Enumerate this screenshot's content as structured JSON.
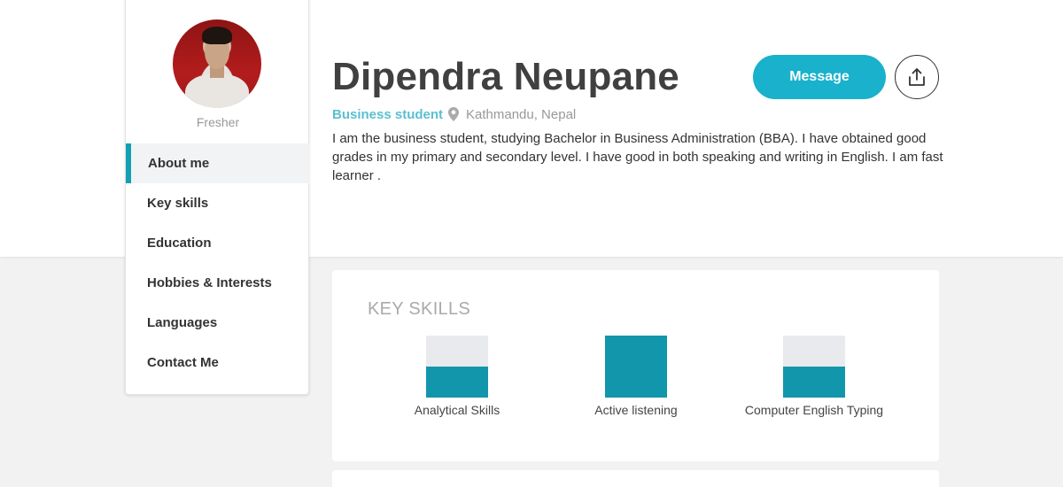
{
  "profile": {
    "name": "Dipendra Neupane",
    "role": "Business student",
    "location": "Kathmandu, Nepal",
    "status": "Fresher",
    "bio": "I am the business student, studying Bachelor in Business Administration (BBA). I have obtained good grades in my primary and secondary level. I have good in both speaking and writing in English. I am fast learner ."
  },
  "actions": {
    "message_label": "Message",
    "share_icon": "share-upload-icon"
  },
  "sidebar": {
    "items": [
      {
        "label": "About me",
        "active": true
      },
      {
        "label": "Key skills",
        "active": false
      },
      {
        "label": "Education",
        "active": false
      },
      {
        "label": "Hobbies & Interests",
        "active": false
      },
      {
        "label": "Languages",
        "active": false
      },
      {
        "label": "Contact Me",
        "active": false
      }
    ]
  },
  "skills": {
    "title": "KEY SKILLS",
    "items": [
      {
        "label": "Analytical Skills",
        "level": 0.5
      },
      {
        "label": "Active listening",
        "level": 1.0
      },
      {
        "label": "Computer English Typing",
        "level": 0.5
      }
    ]
  },
  "colors": {
    "accent": "#19b1cc",
    "skill_fill": "#1296ab",
    "role_text": "#5bbfd0"
  }
}
